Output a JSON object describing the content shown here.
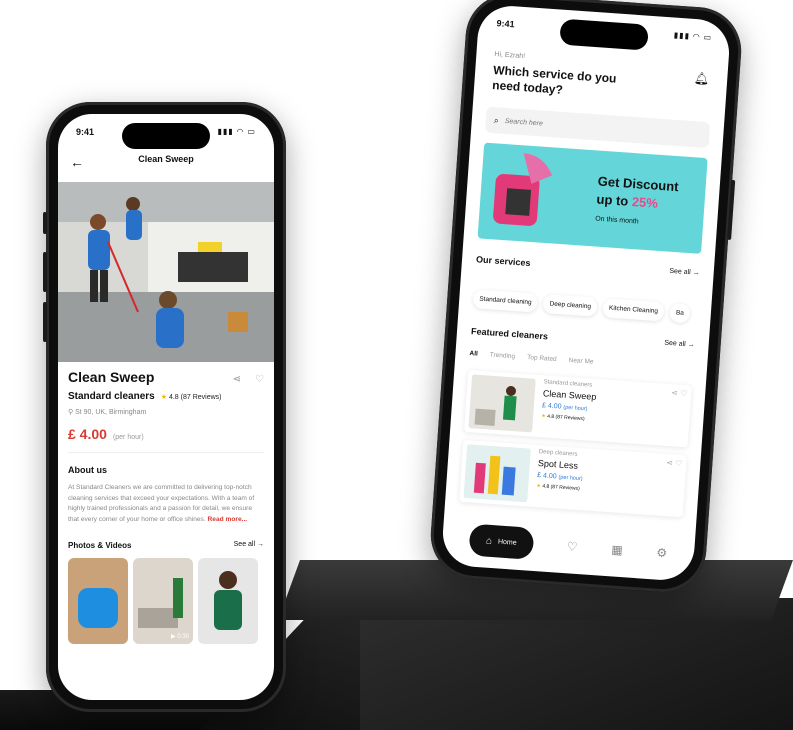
{
  "left_phone": {
    "time": "9:41",
    "nav_title": "Clean Sweep",
    "title": "Clean Sweep",
    "subtitle": "Standard cleaners",
    "rating": "4.8 (87 Reviews)",
    "location": "St 90, UK, Birmingham",
    "price": "£ 4.00",
    "price_unit": "(per hour)",
    "about_heading": "About us",
    "about_text": "At Standard Cleaners we are committed to delivering top-notch cleaning services that exceed your expectations. With a team of highly trained professionals and a passion for detail, we ensure that every corner of your home or office shines.",
    "read_more": "Read more...",
    "photos_heading": "Photos & Videos",
    "see_all": "See all",
    "video_duration": "0:30"
  },
  "right_phone": {
    "time": "9:41",
    "greeting": "Hi, Ezrah!",
    "question": "Which service do you need today?",
    "search_placeholder": "Search here",
    "banner": {
      "line1": "Get Discount",
      "line2": "up to",
      "percent": "25%",
      "sub": "On this month"
    },
    "services_heading": "Our services",
    "services_see_all": "See all",
    "services": [
      "Standard cleaning",
      "Deep cleaning",
      "Kitchen Cleaning",
      "Ba"
    ],
    "featured_heading": "Featured cleaners",
    "featured_see_all": "See all",
    "tabs": [
      "All",
      "Trending",
      "Top Rated",
      "Near Me"
    ],
    "cleaners": [
      {
        "category": "Standard cleaners",
        "name": "Clean Sweep",
        "price": "£ 4.00",
        "unit": "(per hour)",
        "rating": "4.8 (87 Reviews)"
      },
      {
        "category": "Deep cleaners",
        "name": "Spot Less",
        "price": "£ 4.00",
        "unit": "(per hour)",
        "rating": "4.8 (87 Reviews)"
      }
    ],
    "tabbar_home": "Home"
  },
  "colors": {
    "accent_red": "#d93a32",
    "banner_bg": "#64d6d9",
    "price_blue": "#2a7ad9",
    "star": "#f2b705"
  }
}
